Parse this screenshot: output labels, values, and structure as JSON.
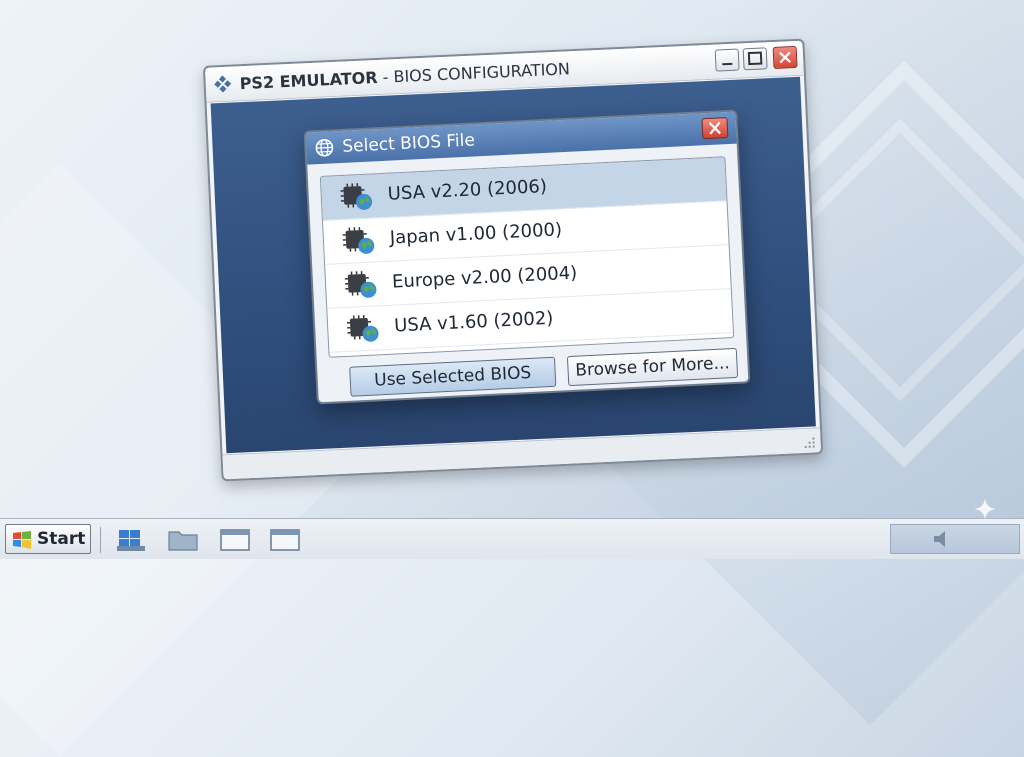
{
  "main_window": {
    "title_bold": "PS2 EMULATOR",
    "title_rest": " - BIOS CONFIGURATION",
    "icon": "diamond-grid-icon",
    "controls": [
      "minimize-icon",
      "maximize-icon",
      "close-icon"
    ]
  },
  "dialog": {
    "title": "Select BIOS File",
    "icon": "globe-icon",
    "bios_files": [
      {
        "label": "USA v2.20 (2006)",
        "selected": true,
        "icon": "chip-globe-icon"
      },
      {
        "label": "Japan v1.00 (2000)",
        "selected": false,
        "icon": "chip-globe-icon"
      },
      {
        "label": "Europe v2.00 (2004)",
        "selected": false,
        "icon": "chip-globe-icon"
      },
      {
        "label": "USA v1.60 (2002)",
        "selected": false,
        "icon": "chip-globe-icon"
      }
    ],
    "buttons": {
      "use_selected": "Use Selected BIOS",
      "browse": "Browse for More..."
    }
  },
  "taskbar": {
    "start_label": "Start",
    "pinned_icons": [
      "windows-icon",
      "folder-icon",
      "window-icon",
      "window-icon"
    ],
    "tray_icons": [
      "speaker-icon"
    ]
  },
  "colors": {
    "workspace": "#2f4f7d",
    "dialog_title": "#4a71a8",
    "selection": "#c5d5e8",
    "close_button": "#d0483a"
  }
}
